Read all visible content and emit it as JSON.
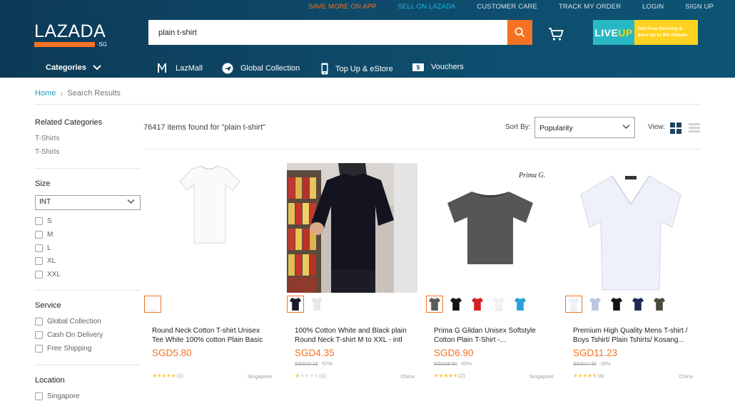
{
  "top_links": [
    "SAVE MORE ON APP",
    "SELL ON LAZADA",
    "CUSTOMER CARE",
    "TRACK MY ORDER",
    "LOGIN",
    "SIGN UP"
  ],
  "logo": {
    "word": "LAZADA",
    "suffix": "·SG"
  },
  "search": {
    "value": "plain t-shirt"
  },
  "liveup": {
    "logo_a": "LIVE",
    "logo_b": "UP",
    "promo_line1": "Get Free Delivery &",
    "promo_line2": "earn up to 8% Rebate"
  },
  "nav": {
    "categories": "Categories",
    "lazmall": "LazMall",
    "global": "Global Collection",
    "topup": "Top Up & eStore",
    "vouchers": "Vouchers"
  },
  "breadcrumb": {
    "home": "Home",
    "current": "Search Results"
  },
  "sidebar": {
    "related_title": "Related Categories",
    "related": [
      "T-Shirts",
      "T-Shirts"
    ],
    "size_title": "Size",
    "size_select": "INT",
    "sizes": [
      "S",
      "M",
      "L",
      "XL",
      "XXL"
    ],
    "service_title": "Service",
    "services": [
      "Global Collection",
      "Cash On Delivery",
      "Free Shipping"
    ],
    "location_title": "Location",
    "locations": [
      "Singapore"
    ]
  },
  "results": {
    "count_text": "76417 items found for \"plain t-shirt\"",
    "sort_label": "Sort By:",
    "sort_value": "Popularity",
    "view_label": "View:"
  },
  "products": [
    {
      "name": "Round Neck Cotton T-shirt Unisex Tee White 100% cotton Plain Basic",
      "price": "SGD5.80",
      "orig": "",
      "discount": "",
      "rating_count": "(1)",
      "stars": 5,
      "location": "Singapore",
      "swatches": [
        "#ffffff"
      ]
    },
    {
      "name": "100% Cotton White and Black plain Round Neck T-shirt M to XXL - intl",
      "price": "SGD4.35",
      "orig": "SGD10.16",
      "discount": "-57%",
      "rating_count": "(1)",
      "stars": 1,
      "location": "China",
      "swatches": [
        "#1a1a2a",
        "#e8e8e8"
      ]
    },
    {
      "name": "Prima G Gildan Unisex Softstyle Cotton Plain T-Shirt -...",
      "price": "SGD6.90",
      "orig": "SGD19.90",
      "discount": "-65%",
      "rating_count": "(2)",
      "stars": 5,
      "location": "Singapore",
      "swatches": [
        "#5a5a5a",
        "#111111",
        "#d42020",
        "#f0f0f5",
        "#2aa0d8"
      ]
    },
    {
      "name": "Premium High Quality Mens T-shirt / Boys Tshirt/ Plain Tshirts/ Kosang...",
      "price": "SGD11.23",
      "orig": "SGD17.40",
      "discount": "-35%",
      "rating_count": "(4)",
      "stars": 5,
      "location": "China",
      "swatches": [
        "#eef2fb",
        "#b8c8dc",
        "#111111",
        "#1c2a55",
        "#4a4a3a"
      ]
    }
  ]
}
